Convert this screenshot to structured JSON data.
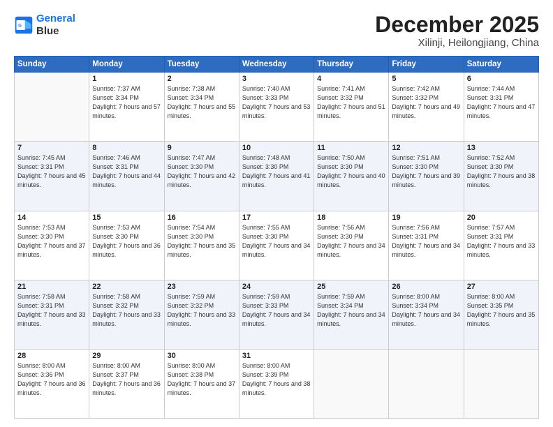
{
  "logo": {
    "line1": "General",
    "line2": "Blue"
  },
  "title": "December 2025",
  "subtitle": "Xilinji, Heilongjiang, China",
  "weekdays": [
    "Sunday",
    "Monday",
    "Tuesday",
    "Wednesday",
    "Thursday",
    "Friday",
    "Saturday"
  ],
  "weeks": [
    [
      {
        "day": "",
        "info": ""
      },
      {
        "day": "1",
        "info": "Sunrise: 7:37 AM\nSunset: 3:34 PM\nDaylight: 7 hours\nand 57 minutes."
      },
      {
        "day": "2",
        "info": "Sunrise: 7:38 AM\nSunset: 3:34 PM\nDaylight: 7 hours\nand 55 minutes."
      },
      {
        "day": "3",
        "info": "Sunrise: 7:40 AM\nSunset: 3:33 PM\nDaylight: 7 hours\nand 53 minutes."
      },
      {
        "day": "4",
        "info": "Sunrise: 7:41 AM\nSunset: 3:32 PM\nDaylight: 7 hours\nand 51 minutes."
      },
      {
        "day": "5",
        "info": "Sunrise: 7:42 AM\nSunset: 3:32 PM\nDaylight: 7 hours\nand 49 minutes."
      },
      {
        "day": "6",
        "info": "Sunrise: 7:44 AM\nSunset: 3:31 PM\nDaylight: 7 hours\nand 47 minutes."
      }
    ],
    [
      {
        "day": "7",
        "info": "Sunrise: 7:45 AM\nSunset: 3:31 PM\nDaylight: 7 hours\nand 45 minutes."
      },
      {
        "day": "8",
        "info": "Sunrise: 7:46 AM\nSunset: 3:31 PM\nDaylight: 7 hours\nand 44 minutes."
      },
      {
        "day": "9",
        "info": "Sunrise: 7:47 AM\nSunset: 3:30 PM\nDaylight: 7 hours\nand 42 minutes."
      },
      {
        "day": "10",
        "info": "Sunrise: 7:48 AM\nSunset: 3:30 PM\nDaylight: 7 hours\nand 41 minutes."
      },
      {
        "day": "11",
        "info": "Sunrise: 7:50 AM\nSunset: 3:30 PM\nDaylight: 7 hours\nand 40 minutes."
      },
      {
        "day": "12",
        "info": "Sunrise: 7:51 AM\nSunset: 3:30 PM\nDaylight: 7 hours\nand 39 minutes."
      },
      {
        "day": "13",
        "info": "Sunrise: 7:52 AM\nSunset: 3:30 PM\nDaylight: 7 hours\nand 38 minutes."
      }
    ],
    [
      {
        "day": "14",
        "info": "Sunrise: 7:53 AM\nSunset: 3:30 PM\nDaylight: 7 hours\nand 37 minutes."
      },
      {
        "day": "15",
        "info": "Sunrise: 7:53 AM\nSunset: 3:30 PM\nDaylight: 7 hours\nand 36 minutes."
      },
      {
        "day": "16",
        "info": "Sunrise: 7:54 AM\nSunset: 3:30 PM\nDaylight: 7 hours\nand 35 minutes."
      },
      {
        "day": "17",
        "info": "Sunrise: 7:55 AM\nSunset: 3:30 PM\nDaylight: 7 hours\nand 34 minutes."
      },
      {
        "day": "18",
        "info": "Sunrise: 7:56 AM\nSunset: 3:30 PM\nDaylight: 7 hours\nand 34 minutes."
      },
      {
        "day": "19",
        "info": "Sunrise: 7:56 AM\nSunset: 3:31 PM\nDaylight: 7 hours\nand 34 minutes."
      },
      {
        "day": "20",
        "info": "Sunrise: 7:57 AM\nSunset: 3:31 PM\nDaylight: 7 hours\nand 33 minutes."
      }
    ],
    [
      {
        "day": "21",
        "info": "Sunrise: 7:58 AM\nSunset: 3:31 PM\nDaylight: 7 hours\nand 33 minutes."
      },
      {
        "day": "22",
        "info": "Sunrise: 7:58 AM\nSunset: 3:32 PM\nDaylight: 7 hours\nand 33 minutes."
      },
      {
        "day": "23",
        "info": "Sunrise: 7:59 AM\nSunset: 3:32 PM\nDaylight: 7 hours\nand 33 minutes."
      },
      {
        "day": "24",
        "info": "Sunrise: 7:59 AM\nSunset: 3:33 PM\nDaylight: 7 hours\nand 34 minutes."
      },
      {
        "day": "25",
        "info": "Sunrise: 7:59 AM\nSunset: 3:34 PM\nDaylight: 7 hours\nand 34 minutes."
      },
      {
        "day": "26",
        "info": "Sunrise: 8:00 AM\nSunset: 3:34 PM\nDaylight: 7 hours\nand 34 minutes."
      },
      {
        "day": "27",
        "info": "Sunrise: 8:00 AM\nSunset: 3:35 PM\nDaylight: 7 hours\nand 35 minutes."
      }
    ],
    [
      {
        "day": "28",
        "info": "Sunrise: 8:00 AM\nSunset: 3:36 PM\nDaylight: 7 hours\nand 36 minutes."
      },
      {
        "day": "29",
        "info": "Sunrise: 8:00 AM\nSunset: 3:37 PM\nDaylight: 7 hours\nand 36 minutes."
      },
      {
        "day": "30",
        "info": "Sunrise: 8:00 AM\nSunset: 3:38 PM\nDaylight: 7 hours\nand 37 minutes."
      },
      {
        "day": "31",
        "info": "Sunrise: 8:00 AM\nSunset: 3:39 PM\nDaylight: 7 hours\nand 38 minutes."
      },
      {
        "day": "",
        "info": ""
      },
      {
        "day": "",
        "info": ""
      },
      {
        "day": "",
        "info": ""
      }
    ]
  ]
}
